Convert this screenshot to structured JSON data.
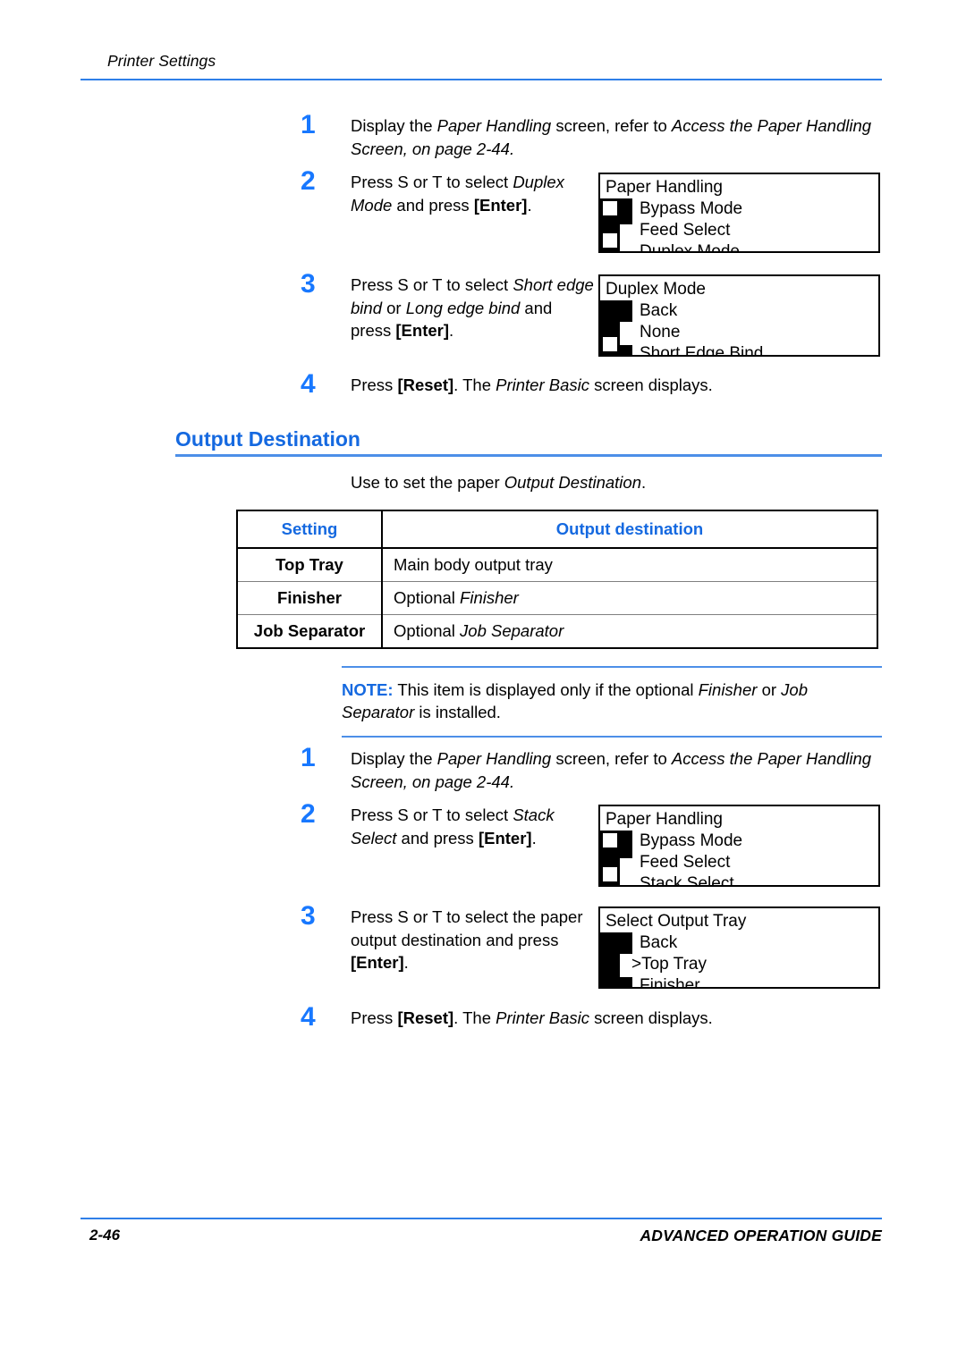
{
  "header": {
    "running_head": "Printer Settings"
  },
  "procedure_one": {
    "steps": [
      {
        "num": "1",
        "text_plain": "Display the Paper Handling screen, refer to Access the Paper Handling Screen, on page 2-44.",
        "line1_a": "Display the ",
        "line1_i": "Paper Handling",
        "line1_b": " screen, refer to ",
        "line1_i2": "Access the Paper Handling",
        "line2_i": "Screen, on page 2-44",
        "line2_end": "."
      },
      {
        "num": "2",
        "text_plain": "Press S or T to select Duplex Mode and press [Enter].",
        "pre": "Press  S or  T to select ",
        "italic": "Duplex Mode",
        "mid": " and press ",
        "key": "[Enter]",
        "post": "."
      },
      {
        "num": "3",
        "text_plain": "Press S or T to select Short edge bind or Long edge bind and press [Enter].",
        "pre": "Press  S or  T to select ",
        "italic": "Short edge bind",
        "mid": " or ",
        "italic2": "Long edge bind",
        "mid2": " and press ",
        "key": "[Enter]",
        "post": "."
      },
      {
        "num": "4",
        "text_plain": "Press [Reset]. The Printer Basic screen displays.",
        "pre": "Press ",
        "key": "[Reset]",
        "mid": ". The ",
        "italic": "Printer Basic",
        "post": " screen displays."
      }
    ]
  },
  "lcd_panels": [
    {
      "id": "paper-handling-duplex",
      "title": "Paper Handling",
      "items": [
        "Bypass Mode",
        "Feed Select",
        "Duplex Mode"
      ],
      "cursor_item": null,
      "scroll_thumb_position": "bottom",
      "top_arrow": true,
      "bottom_arrow": true
    },
    {
      "id": "duplex-mode",
      "title": "Duplex Mode",
      "items": [
        "Back",
        "None",
        "Short Edge Bind"
      ],
      "cursor_item": null,
      "scroll_thumb_position": "middle",
      "top_arrow": false,
      "bottom_arrow": true
    },
    {
      "id": "paper-handling-stack",
      "title": "Paper Handling",
      "items": [
        "Bypass Mode",
        "Feed Select",
        "Stack Select"
      ],
      "cursor_item": null,
      "scroll_thumb_position": "bottom",
      "top_arrow": true,
      "bottom_arrow": true
    },
    {
      "id": "select-output-tray",
      "title": "Select Output Tray",
      "items": [
        "Back",
        ">Top Tray",
        "Finisher"
      ],
      "cursor_item": "Top Tray",
      "scroll_thumb_position": "middle",
      "top_arrow": false,
      "bottom_arrow": false
    }
  ],
  "section": {
    "heading": "Output Destination",
    "lead_pre": "Use to set the paper ",
    "lead_italic": "Output Destination",
    "lead_post": "."
  },
  "table": {
    "columns": [
      "Setting",
      "Output destination"
    ],
    "rows": [
      {
        "setting": "Top Tray",
        "dest_pre": "Main body output tray",
        "dest_italic": ""
      },
      {
        "setting": "Finisher",
        "dest_pre": "Optional ",
        "dest_italic": "Finisher"
      },
      {
        "setting": "Job Separator",
        "dest_pre": "Optional ",
        "dest_italic": "Job Separator"
      }
    ]
  },
  "note": {
    "label": "NOTE:",
    "pre": " This item is displayed only if the optional ",
    "italic1": "Finisher",
    "mid": " or ",
    "italic2": "Job Separator",
    "post": " is installed."
  },
  "procedure_two": {
    "steps": [
      {
        "num": "1",
        "text_plain": "Display the Paper Handling screen, refer to Access the Paper Handling Screen, on page 2-44.",
        "line1_a": "Display the ",
        "line1_i": "Paper Handling",
        "line1_b": " screen, refer to ",
        "line1_i2": "Access the Paper Handling",
        "line2_i": "Screen, on page 2-44",
        "line2_end": "."
      },
      {
        "num": "2",
        "text_plain": "Press S or T to select Stack Select and press [Enter].",
        "pre": "Press  S or  T to select ",
        "italic": "Stack Select",
        "mid": " and press ",
        "key": "[Enter]",
        "post": "."
      },
      {
        "num": "3",
        "text_plain": "Press S or T to select the paper output destination and press [Enter].",
        "pre": "Press  S or  T to select the paper output destination and press ",
        "key": "[Enter]",
        "post": "."
      },
      {
        "num": "4",
        "text_plain": "Press [Reset]. The Printer Basic screen displays.",
        "pre": "Press ",
        "key": "[Reset]",
        "mid": ". The ",
        "italic": "Printer Basic",
        "post": " screen displays."
      }
    ]
  },
  "footer": {
    "page_number": "2-46",
    "guide_title": "ADVANCED OPERATION GUIDE"
  },
  "colors": {
    "heading_blue": "#1569e0",
    "step_number_blue": "#1878ff",
    "rule_blue": "#2f7fe8",
    "note_rule_blue": "#4d8fe8"
  }
}
